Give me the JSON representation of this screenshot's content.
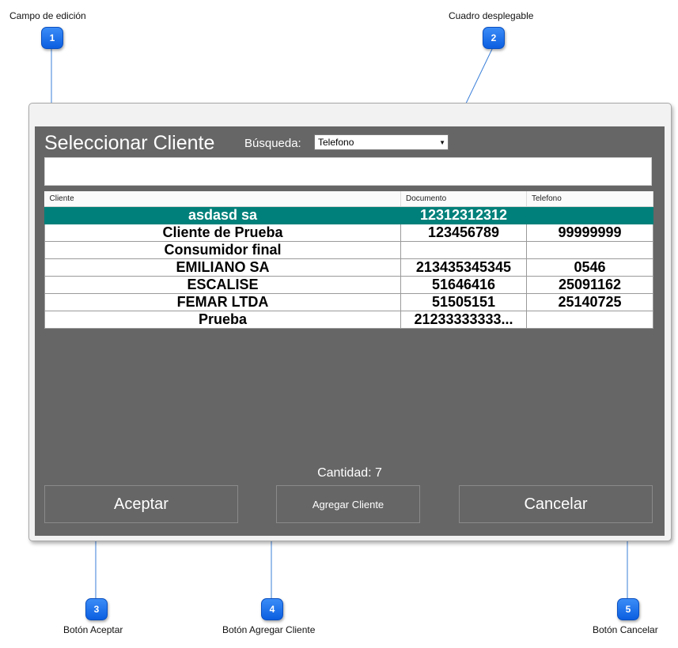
{
  "callouts": [
    {
      "number": "1",
      "label": "Campo de edición"
    },
    {
      "number": "2",
      "label": "Cuadro desplegable"
    },
    {
      "number": "3",
      "label": "Botón Aceptar"
    },
    {
      "number": "4",
      "label": "Botón Agregar Cliente"
    },
    {
      "number": "5",
      "label": "Botón Cancelar"
    }
  ],
  "dialog": {
    "title": "Seleccionar Cliente",
    "search_label": "Búsqueda:",
    "search_field_selected": "Telefono",
    "search_input_value": "",
    "columns": [
      "Cliente",
      "Documento",
      "Telefono"
    ],
    "rows": [
      {
        "cliente": "asdasd sa",
        "documento": "12312312312",
        "telefono": "",
        "selected": true
      },
      {
        "cliente": "Cliente de Prueba",
        "documento": "123456789",
        "telefono": "99999999"
      },
      {
        "cliente": "Consumidor final",
        "documento": "",
        "telefono": ""
      },
      {
        "cliente": "EMILIANO SA",
        "documento": "213435345345",
        "telefono": "0546"
      },
      {
        "cliente": "ESCALISE",
        "documento": "51646416",
        "telefono": "25091162"
      },
      {
        "cliente": "FEMAR LTDA",
        "documento": "51505151",
        "telefono": "25140725"
      },
      {
        "cliente": "Prueba",
        "documento": "21233333333...",
        "telefono": ""
      }
    ],
    "count_text": "Cantidad: 7",
    "accept_label": "Aceptar",
    "add_client_label": "Agregar Cliente",
    "cancel_label": "Cancelar"
  },
  "colors": {
    "panel_bg": "#666666",
    "selected_row": "#00807a",
    "badge": "#1a73ec"
  }
}
